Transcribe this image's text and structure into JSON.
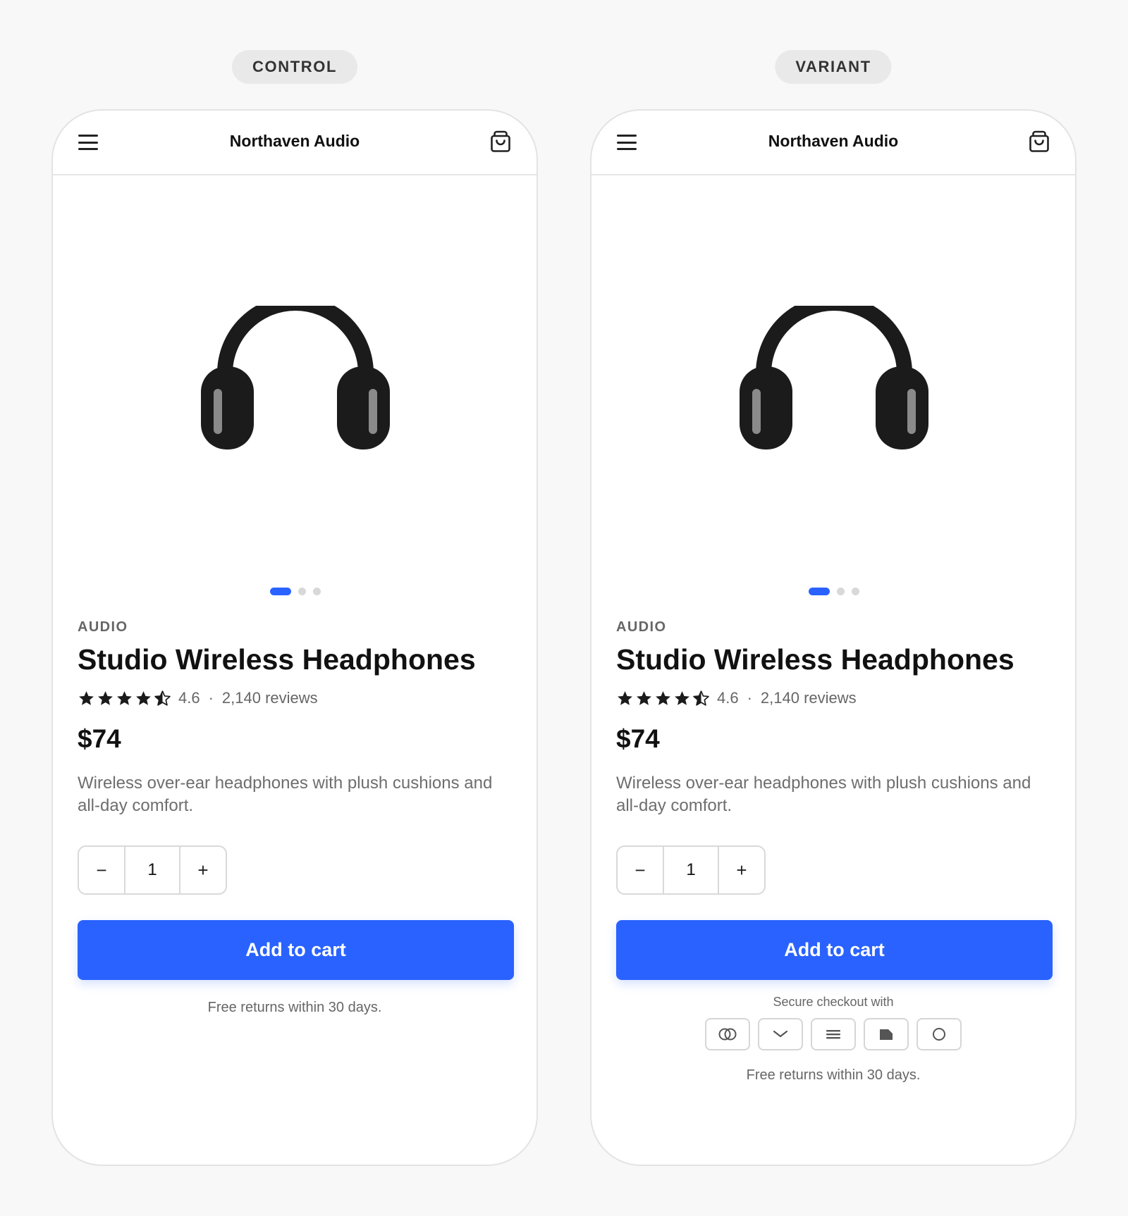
{
  "control": {
    "label": "CONTROL",
    "brand": "Northaven Audio",
    "category": "AUDIO",
    "product_title": "Studio Wireless Headphones",
    "rating_value": "4.6",
    "rating_separator": "·",
    "review_count": "2,140 reviews",
    "stars": 4.5,
    "price": "$74",
    "description": "Wireless over-ear headphones with plush cushions and all-day comfort.",
    "quantity": "1",
    "qty_minus": "−",
    "qty_plus": "+",
    "add_to_cart": "Add to cart",
    "returns": "Free returns within 30 days.",
    "carousel_active": 1,
    "carousel_count": 3
  },
  "variant": {
    "label": "VARIANT",
    "brand": "Northaven Audio",
    "category": "AUDIO",
    "product_title": "Studio Wireless Headphones",
    "rating_value": "4.6",
    "rating_separator": "·",
    "review_count": "2,140 reviews",
    "stars": 4.5,
    "price": "$74",
    "description": "Wireless over-ear headphones with plush cushions and all-day comfort.",
    "quantity": "1",
    "qty_minus": "−",
    "qty_plus": "+",
    "add_to_cart": "Add to cart",
    "secure_checkout": "Secure checkout with",
    "payment_icons": [
      "linked-circles-icon",
      "chevron-down-icon",
      "list-lines-icon",
      "folded-card-icon",
      "circle-icon"
    ],
    "returns": "Free returns within 30 days.",
    "carousel_active": 1,
    "carousel_count": 3
  },
  "colors": {
    "accent": "#2962ff",
    "page_background": "#f8f8f8",
    "pill_background": "#e9e9e9",
    "headphone_dark": "#1b1b1b",
    "headphone_highlight": "#8a8a8a"
  }
}
